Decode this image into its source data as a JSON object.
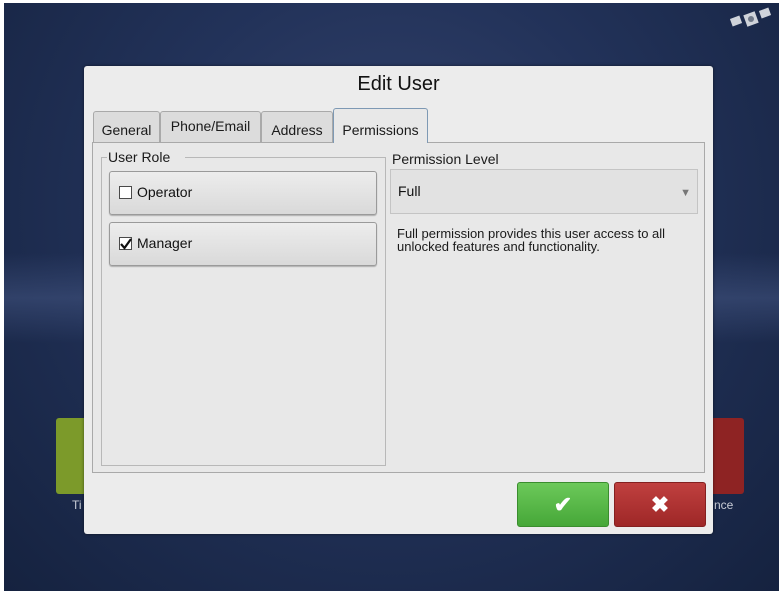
{
  "background": {
    "left_app_label": "Ti",
    "right_app_label": "nce",
    "left_tile_color": "#7c9a2a",
    "right_tile_color": "#8e2323"
  },
  "dialog": {
    "title": "Edit User",
    "tabs": [
      {
        "label": "General",
        "active": false
      },
      {
        "label": "Phone/Email",
        "active": false
      },
      {
        "label": "Address",
        "active": false
      },
      {
        "label": "Permissions",
        "active": true
      }
    ],
    "user_role": {
      "label": "User Role",
      "options": [
        {
          "label": "Operator",
          "checked": false
        },
        {
          "label": "Manager",
          "checked": true
        }
      ]
    },
    "permission_level": {
      "label": "Permission Level",
      "value": "Full",
      "description": "Full permission provides this user access to all unlocked features and functionality."
    },
    "buttons": {
      "ok_icon": "checkmark-icon",
      "ok_symbol": "✔",
      "ok_color": "#46a738",
      "cancel_icon": "close-icon",
      "cancel_symbol": "✖",
      "cancel_color": "#9e2727"
    }
  }
}
